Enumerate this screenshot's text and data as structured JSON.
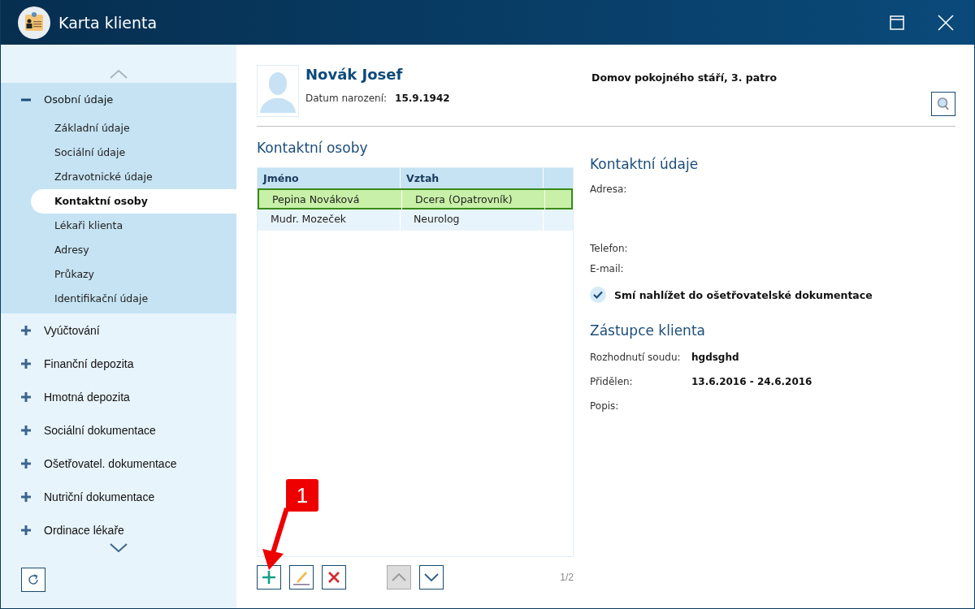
{
  "window": {
    "title": "Karta klienta"
  },
  "sidebar": {
    "sections": [
      {
        "label": "Osobní údaje",
        "expanded": true,
        "children": [
          {
            "label": "Základní údaje",
            "selected": false
          },
          {
            "label": "Sociální údaje",
            "selected": false
          },
          {
            "label": "Zdravotnické údaje",
            "selected": false
          },
          {
            "label": "Kontaktní osoby",
            "selected": true
          },
          {
            "label": "Lékaři klienta",
            "selected": false
          },
          {
            "label": "Adresy",
            "selected": false
          },
          {
            "label": "Průkazy",
            "selected": false
          },
          {
            "label": "Identifikační údaje",
            "selected": false
          }
        ]
      },
      {
        "label": "Vyúčtování",
        "expanded": false
      },
      {
        "label": "Finanční depozita",
        "expanded": false
      },
      {
        "label": "Hmotná depozita",
        "expanded": false
      },
      {
        "label": "Sociální dokumentace",
        "expanded": false
      },
      {
        "label": "Ošetřovatel. dokumentace",
        "expanded": false
      },
      {
        "label": "Nutriční dokumentace",
        "expanded": false
      },
      {
        "label": "Ordinace lékaře",
        "expanded": false
      }
    ]
  },
  "client": {
    "name": "Novák Josef",
    "birth_label": "Datum narození:",
    "birth_date": "15.9.1942",
    "facility": "Domov pokojného stáří, 3. patro"
  },
  "contacts": {
    "title": "Kontaktní osoby",
    "columns": [
      "Jméno",
      "Vztah"
    ],
    "rows": [
      {
        "cells": [
          "Pepina Nováková",
          "Dcera (Opatrovník)"
        ],
        "selected": true
      },
      {
        "cells": [
          "Mudr. Mozeček",
          "Neurolog"
        ],
        "selected": false
      }
    ],
    "toolbar": [
      {
        "kind": "add",
        "disabled": false
      },
      {
        "kind": "edit",
        "disabled": false
      },
      {
        "kind": "delete",
        "disabled": false
      },
      {
        "kind": "up",
        "disabled": true
      },
      {
        "kind": "down",
        "disabled": false
      }
    ],
    "page": "1/2"
  },
  "detail": {
    "title": "Kontaktní údaje",
    "fields": [
      {
        "label": "Adresa:",
        "kind": "tall"
      },
      {
        "label": "Telefon:",
        "kind": "line"
      },
      {
        "label": "E-mail:",
        "kind": "line"
      }
    ],
    "permission": {
      "label": "Smí nahlížet do ošetřovatelské dokumentace",
      "checked": true
    },
    "representative": {
      "title": "Zástupce klienta",
      "fields": [
        {
          "label": "Rozhodnutí soudu:",
          "value": "hgdsghd"
        },
        {
          "label": "Přidělen:",
          "value": "13.6.2016 - 24.6.2016"
        },
        {
          "label": "Popis:"
        }
      ]
    }
  },
  "callout": {
    "text": "1"
  }
}
